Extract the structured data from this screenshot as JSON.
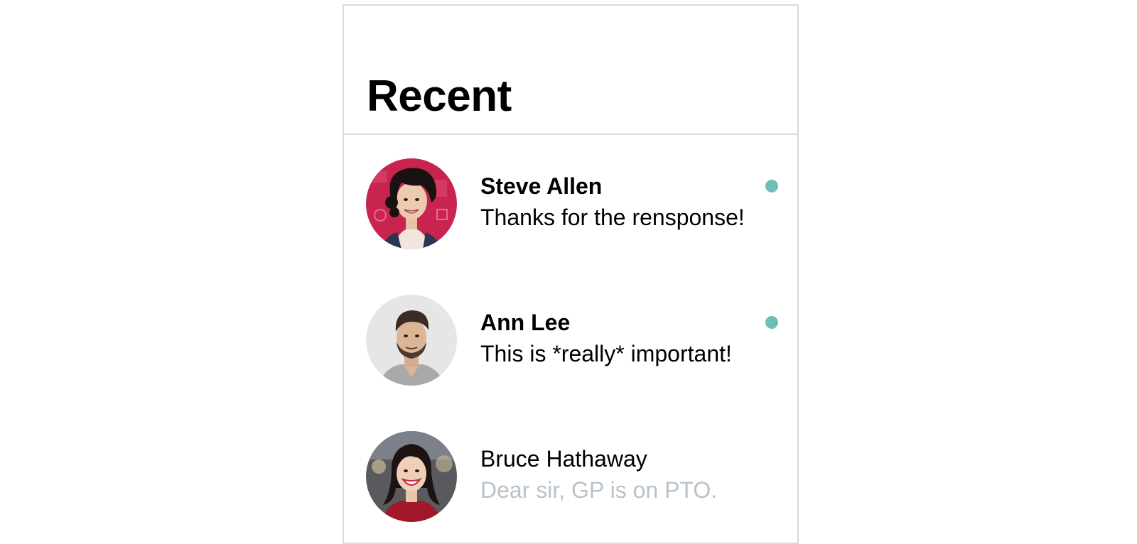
{
  "header": {
    "title": "Recent"
  },
  "colors": {
    "unread_dot": "#6dbfb8",
    "read_message": "#b8c2c8",
    "divider": "#d3dde0"
  },
  "conversations": [
    {
      "name": "Steve Allen",
      "message": "Thanks for the rensponse!",
      "unread": true,
      "avatar": "avatar-curly-hair-woman"
    },
    {
      "name": "Ann Lee",
      "message": "This is *really* important!",
      "unread": true,
      "avatar": "avatar-bearded-man"
    },
    {
      "name": "Bruce Hathaway",
      "message": "Dear sir, GP is on PTO.",
      "unread": false,
      "avatar": "avatar-smiling-woman"
    }
  ]
}
